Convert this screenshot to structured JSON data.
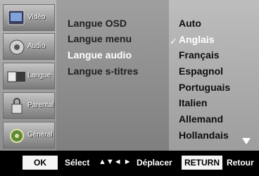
{
  "sidebar": {
    "items": [
      {
        "label": "Vidéo",
        "icon": "video-icon"
      },
      {
        "label": "Audio",
        "icon": "audio-icon"
      },
      {
        "label": "Langue",
        "icon": "language-icon"
      },
      {
        "label": "Parental",
        "icon": "parental-icon"
      },
      {
        "label": "Général",
        "icon": "general-icon"
      }
    ]
  },
  "menu": {
    "options": [
      {
        "label": "Langue OSD"
      },
      {
        "label": "Langue menu"
      },
      {
        "label": "Langue audio"
      },
      {
        "label": "Langue s-titres"
      }
    ]
  },
  "languages": {
    "check_mark": "✓",
    "items": [
      {
        "label": "Auto"
      },
      {
        "label": "Anglais"
      },
      {
        "label": "Français"
      },
      {
        "label": "Espagnol"
      },
      {
        "label": "Portuguais"
      },
      {
        "label": "Italien"
      },
      {
        "label": "Allemand"
      },
      {
        "label": "Hollandais"
      }
    ]
  },
  "footer": {
    "ok_key": "OK",
    "select_label": "Sélect",
    "nav_glyphs": "▲▼◄ ►",
    "move_label": "Déplacer",
    "return_key": "RETURN",
    "return_label": "Retour"
  }
}
